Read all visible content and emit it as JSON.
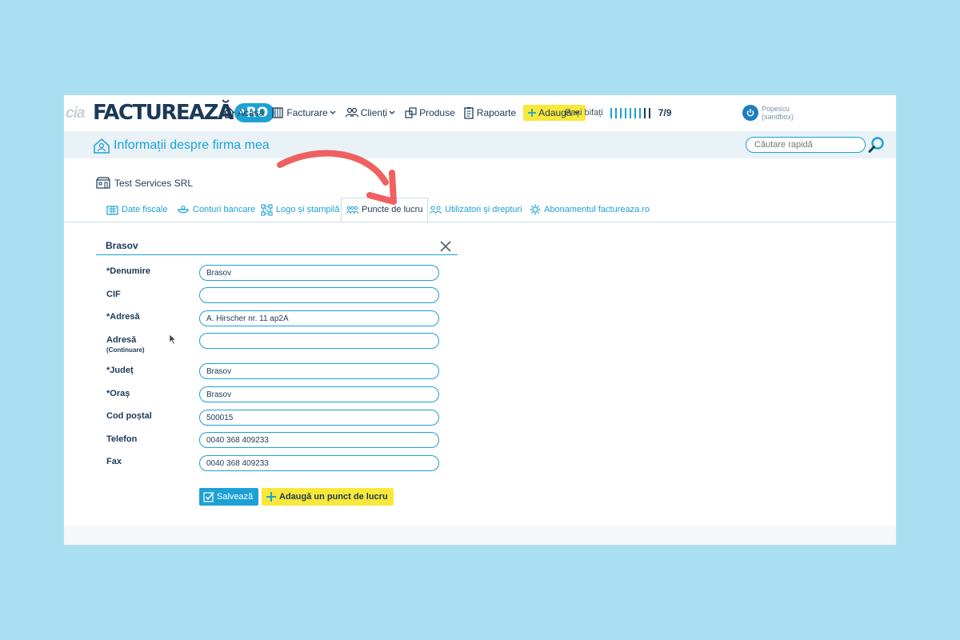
{
  "brand": {
    "ghost_text": "cia",
    "logo_text": "FACTUREAZĂ",
    "logo_badge": "RO"
  },
  "nav": {
    "items": [
      {
        "label": "Acasă",
        "icon": "house-icon"
      },
      {
        "label": "Facturare",
        "icon": "invoice-icon",
        "has_dropdown": true
      },
      {
        "label": "Clienți",
        "icon": "clients-icon",
        "has_dropdown": true
      },
      {
        "label": "Produse",
        "icon": "products-icon"
      },
      {
        "label": "Rapoarte",
        "icon": "reports-icon"
      }
    ],
    "add_label": "Adaugă"
  },
  "steps": {
    "label": "Pași bifați",
    "completed": 7,
    "total": 9,
    "count_text": "7/9"
  },
  "user": {
    "name": "Popescu",
    "env": "(sandbox)"
  },
  "header": {
    "title": "Informații despre firma mea",
    "search_placeholder": "Căutare rapidă"
  },
  "company": {
    "name": "Test Services SRL"
  },
  "tabs": [
    {
      "label": "Date fiscale",
      "icon": "fiscal-icon",
      "active": false
    },
    {
      "label": "Conturi bancare",
      "icon": "bank-icon",
      "active": false
    },
    {
      "label": "Logo și ștampilă",
      "icon": "logo-stamp-icon",
      "active": false
    },
    {
      "label": "Puncte de lucru",
      "icon": "workpoints-icon",
      "active": true
    },
    {
      "label": "Utilizatori și drepturi",
      "icon": "users-icon",
      "active": false
    },
    {
      "label": "Abonamentul factureaza.ro",
      "icon": "subscription-icon",
      "active": false
    }
  ],
  "form": {
    "section_title": "Brasov",
    "fields": [
      {
        "label": "Denumire",
        "required": true,
        "value": ""
      },
      {
        "label": "CIF",
        "required": false,
        "value": ""
      },
      {
        "label": "Adresă",
        "required": true,
        "value": ""
      },
      {
        "label": "Adresă",
        "sub": "(Continuare)",
        "required": false,
        "value": ""
      },
      {
        "label": "Județ",
        "required": true,
        "value": ""
      },
      {
        "label": "Oraș",
        "required": true,
        "value": ""
      },
      {
        "label": "Cod poștal",
        "required": false,
        "value": ""
      },
      {
        "label": "Telefon",
        "required": false,
        "value": ""
      },
      {
        "label": "Fax",
        "required": false,
        "value": ""
      }
    ],
    "values": {
      "denumire": "Brasov",
      "cif": "",
      "adresa": "A. Hirscher nr. 11 ap2A",
      "adresa2": "",
      "judet": "Brasov",
      "oras": "Brasov",
      "cod_postal": "500015",
      "telefon": "0040 368 409233",
      "fax": "0040 368 409233"
    },
    "save_label": "Salvează",
    "add_point_label": "Adaugă un punct de lucru"
  },
  "colors": {
    "accent": "#1da1d4",
    "dark": "#1c3a57",
    "yellow": "#f9e83a",
    "arrow": "#f06060",
    "backdrop": "#aadff2"
  }
}
